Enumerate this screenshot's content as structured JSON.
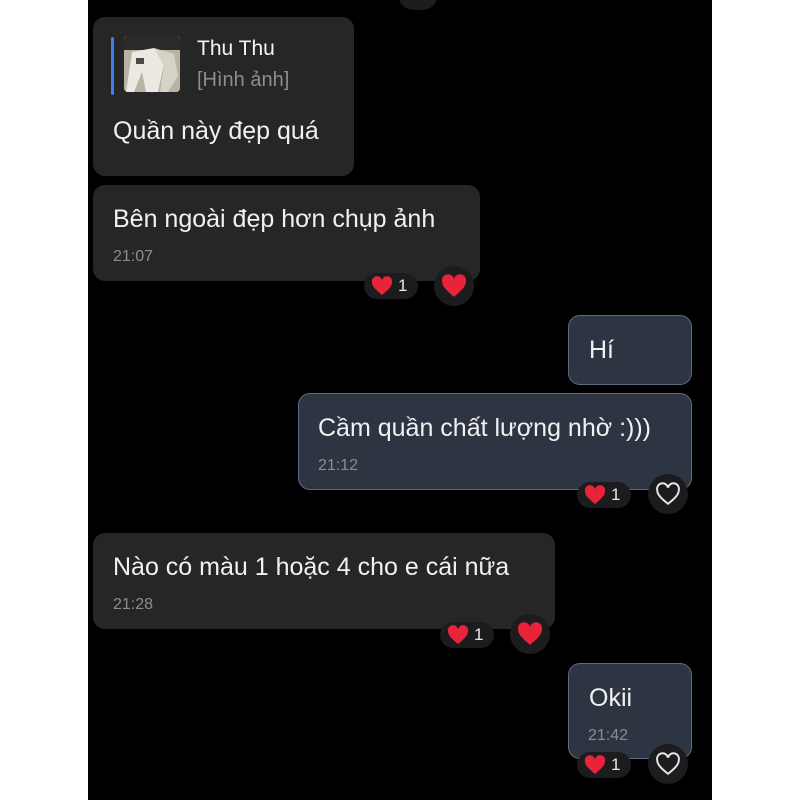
{
  "messages": [
    {
      "id": "m1",
      "direction": "incoming",
      "reply": {
        "name": "Thu Thu",
        "preview": "[Hình ảnh]"
      },
      "text": "Quần này đẹp quá"
    },
    {
      "id": "m2",
      "direction": "incoming",
      "text": "Bên ngoài đẹp hơn chụp ảnh",
      "time": "21:07",
      "reaction": {
        "emoji": "heart",
        "count": "1"
      },
      "react_button": "heart-filled"
    },
    {
      "id": "m3",
      "direction": "outgoing",
      "text": "Hí"
    },
    {
      "id": "m4",
      "direction": "outgoing",
      "text": "Cầm quần chất lượng nhờ :)))",
      "time": "21:12",
      "reaction": {
        "emoji": "heart",
        "count": "1"
      },
      "react_button": "heart-outline"
    },
    {
      "id": "m5",
      "direction": "incoming",
      "text": "Nào có màu 1 hoặc 4 cho e cái nữa",
      "time": "21:28",
      "reaction": {
        "emoji": "heart",
        "count": "1"
      },
      "react_button": "heart-filled"
    },
    {
      "id": "m6",
      "direction": "outgoing",
      "text": "Okii",
      "time": "21:42",
      "reaction": {
        "emoji": "heart",
        "count": "1"
      },
      "react_button": "heart-outline"
    }
  ],
  "colors": {
    "background": "#000000",
    "incoming_bubble": "#262627",
    "outgoing_bubble": "#2d3442",
    "outgoing_border": "#5f6b80",
    "reply_accent": "#3d7ef0",
    "heart": "#e8233a",
    "timestamp": "#8b8d92"
  }
}
